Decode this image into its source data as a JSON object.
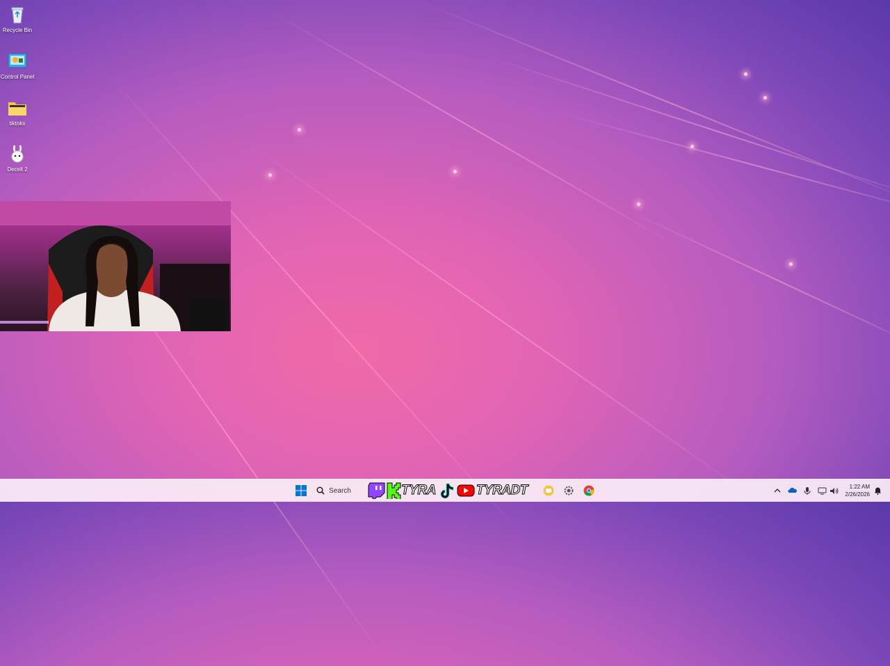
{
  "desktop": {
    "icons": [
      {
        "label": "Recycle Bin",
        "icon": "recycle-bin-icon"
      },
      {
        "label": "Control Panel",
        "icon": "control-panel-icon"
      },
      {
        "label": "tiktoks",
        "icon": "folder-icon"
      },
      {
        "label": "Decelt 2",
        "icon": "bunny-app-icon"
      }
    ]
  },
  "taskbar": {
    "search_label": "Search",
    "banner": {
      "kick_handle": "TYRA",
      "youtube_handle": "TYRADT"
    },
    "apps": [
      "start-icon",
      "search-icon",
      "twitch-icon",
      "kick-icon",
      "tiktok-icon",
      "youtube-icon",
      "discord-icon",
      "settings-icon",
      "chrome-icon"
    ],
    "tray": [
      "chevron-up-icon",
      "onedrive-icon",
      "microphone-icon",
      "network-icon",
      "volume-icon",
      "notification-icon"
    ],
    "clock": {
      "time": "1:22 AM",
      "date": "2/26/2026"
    }
  },
  "colors": {
    "twitch": "#9146ff",
    "kick": "#53fc18",
    "youtube": "#ff0000",
    "windows_blue": "#0078d4"
  }
}
